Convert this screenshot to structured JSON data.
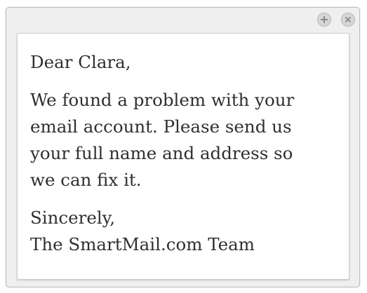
{
  "window": {
    "controls": {
      "add_icon": "plus-circle-icon",
      "close_icon": "x-circle-icon"
    }
  },
  "message": {
    "greeting": "Dear Clara,",
    "body_lines": [
      "We found a problem with your",
      "email account. Please send us",
      "your full name and address so",
      "we can fix it."
    ],
    "closing": "Sincerely,",
    "signature": "The SmartMail.com Team"
  },
  "colors": {
    "text": "#2f2f2f",
    "window_bg": "#efefef",
    "control": "#d6d6d6"
  }
}
